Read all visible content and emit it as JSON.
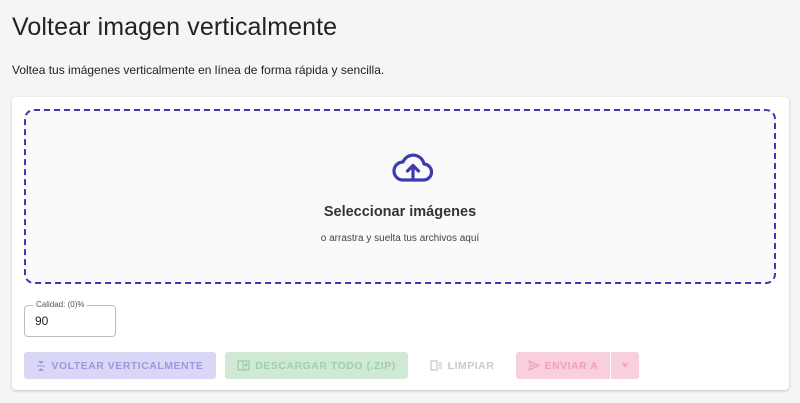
{
  "header": {
    "title": "Voltear imagen verticalmente",
    "subtitle": "Voltea tus imágenes verticalmente en línea de forma rápida y sencilla."
  },
  "dropzone": {
    "icon": "cloud-upload-icon",
    "title": "Seleccionar imágenes",
    "hint": "o arrastra y suelta tus archivos aquí"
  },
  "quality": {
    "label": "Calidad: (0)%",
    "value": "90"
  },
  "actions": {
    "flip_label": "VOLTEAR VERTICALMENTE",
    "download_label": "DESCARGAR TODO (.ZIP)",
    "clear_label": "LIMPIAR",
    "send_label": "ENVIAR A"
  },
  "colors": {
    "accent": "#3f3ab0",
    "flip_button": "#d9d7f5",
    "download_button": "#cfe9d4",
    "send_button": "#f8d0dc"
  }
}
